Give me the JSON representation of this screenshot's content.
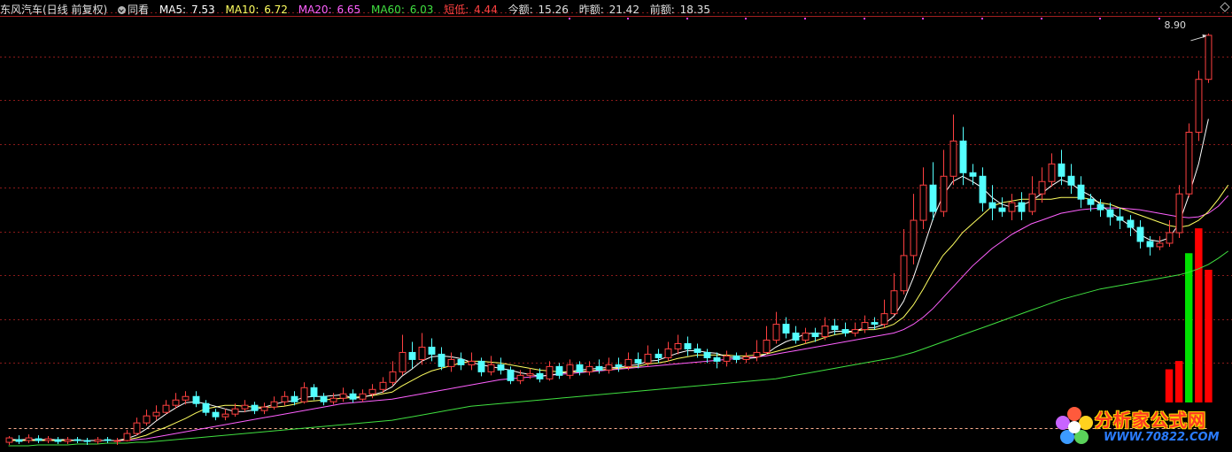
{
  "header": {
    "title": "东风汽车(日线 前复权)",
    "same_view": "同看",
    "ma5_label": "MA5:",
    "ma5_value": "7.53",
    "ma10_label": "MA10:",
    "ma10_value": "6.72",
    "ma20_label": "MA20:",
    "ma20_value": "6.65",
    "ma60_label": "MA60:",
    "ma60_value": "6.03",
    "short_low_label": "短低:",
    "short_low_value": "4.44",
    "today_amount_label": "今额:",
    "today_amount_value": "15.26",
    "yesterday_amount_label": "昨额:",
    "yesterday_amount_value": "21.42",
    "prev_amount_label": "前额:",
    "prev_amount_value": "18.35"
  },
  "price_high_label": "8.90",
  "watermark": {
    "name": "分析家公式网",
    "url": "WWW.70822.COM"
  },
  "colors": {
    "up": "#ff4040",
    "down": "#54ffff",
    "ma5": "#ffffff",
    "ma10": "#ffff60",
    "ma20": "#ff60ff",
    "ma60": "#40e040",
    "grid": "#8a1a1a",
    "amount_up": "#ff0000",
    "amount_down": "#00e000",
    "dots": "#ff40ff"
  },
  "chart_data": {
    "type": "candlestick",
    "title": "东风汽车(日线 前复权)",
    "ylim": [
      4.2,
      9.1
    ],
    "high_mark": 8.9,
    "short_low": 4.44,
    "candles": [
      [
        4.28,
        4.33,
        4.25,
        4.35
      ],
      [
        4.31,
        4.29,
        4.26,
        4.36
      ],
      [
        4.3,
        4.33,
        4.27,
        4.37
      ],
      [
        4.32,
        4.3,
        4.27,
        4.36
      ],
      [
        4.3,
        4.32,
        4.27,
        4.35
      ],
      [
        4.31,
        4.29,
        4.26,
        4.34
      ],
      [
        4.29,
        4.31,
        4.26,
        4.34
      ],
      [
        4.31,
        4.3,
        4.27,
        4.34
      ],
      [
        4.3,
        4.29,
        4.25,
        4.33
      ],
      [
        4.29,
        4.31,
        4.26,
        4.34
      ],
      [
        4.31,
        4.3,
        4.27,
        4.34
      ],
      [
        4.29,
        4.3,
        4.25,
        4.33
      ],
      [
        4.3,
        4.38,
        4.29,
        4.42
      ],
      [
        4.38,
        4.5,
        4.36,
        4.56
      ],
      [
        4.5,
        4.58,
        4.47,
        4.65
      ],
      [
        4.58,
        4.62,
        4.53,
        4.7
      ],
      [
        4.62,
        4.7,
        4.6,
        4.76
      ],
      [
        4.7,
        4.76,
        4.66,
        4.84
      ],
      [
        4.76,
        4.8,
        4.71,
        4.86
      ],
      [
        4.8,
        4.72,
        4.68,
        4.86
      ],
      [
        4.72,
        4.62,
        4.58,
        4.76
      ],
      [
        4.62,
        4.57,
        4.53,
        4.66
      ],
      [
        4.57,
        4.6,
        4.53,
        4.66
      ],
      [
        4.6,
        4.66,
        4.57,
        4.72
      ],
      [
        4.66,
        4.7,
        4.62,
        4.76
      ],
      [
        4.7,
        4.64,
        4.6,
        4.74
      ],
      [
        4.64,
        4.68,
        4.6,
        4.73
      ],
      [
        4.68,
        4.74,
        4.65,
        4.8
      ],
      [
        4.74,
        4.8,
        4.7,
        4.86
      ],
      [
        4.8,
        4.74,
        4.7,
        4.86
      ],
      [
        4.74,
        4.9,
        4.72,
        4.96
      ],
      [
        4.9,
        4.8,
        4.76,
        4.94
      ],
      [
        4.8,
        4.74,
        4.7,
        4.84
      ],
      [
        4.74,
        4.78,
        4.71,
        4.84
      ],
      [
        4.78,
        4.83,
        4.74,
        4.9
      ],
      [
        4.83,
        4.77,
        4.73,
        4.88
      ],
      [
        4.77,
        4.83,
        4.74,
        4.88
      ],
      [
        4.83,
        4.88,
        4.78,
        4.94
      ],
      [
        4.88,
        4.96,
        4.84,
        5.02
      ],
      [
        4.96,
        5.08,
        4.92,
        5.2
      ],
      [
        5.08,
        5.3,
        5.04,
        5.5
      ],
      [
        5.3,
        5.22,
        5.12,
        5.42
      ],
      [
        5.22,
        5.36,
        5.16,
        5.52
      ],
      [
        5.36,
        5.28,
        5.2,
        5.46
      ],
      [
        5.28,
        5.14,
        5.1,
        5.36
      ],
      [
        5.14,
        5.22,
        5.08,
        5.3
      ],
      [
        5.22,
        5.16,
        5.1,
        5.3
      ],
      [
        5.16,
        5.2,
        5.1,
        5.3
      ],
      [
        5.2,
        5.08,
        5.03,
        5.24
      ],
      [
        5.08,
        5.16,
        5.04,
        5.26
      ],
      [
        5.16,
        5.1,
        5.05,
        5.24
      ],
      [
        5.1,
        4.98,
        4.94,
        5.14
      ],
      [
        4.98,
        5.04,
        4.94,
        5.1
      ],
      [
        5.04,
        5.06,
        5.0,
        5.12
      ],
      [
        5.06,
        5.0,
        4.96,
        5.12
      ],
      [
        5.0,
        5.14,
        4.98,
        5.2
      ],
      [
        5.14,
        5.04,
        5.0,
        5.18
      ],
      [
        5.04,
        5.16,
        5.0,
        5.22
      ],
      [
        5.16,
        5.08,
        5.04,
        5.2
      ],
      [
        5.08,
        5.14,
        5.04,
        5.2
      ],
      [
        5.14,
        5.1,
        5.06,
        5.22
      ],
      [
        5.1,
        5.16,
        5.06,
        5.24
      ],
      [
        5.16,
        5.14,
        5.08,
        5.24
      ],
      [
        5.14,
        5.22,
        5.1,
        5.3
      ],
      [
        5.22,
        5.18,
        5.12,
        5.3
      ],
      [
        5.18,
        5.28,
        5.14,
        5.38
      ],
      [
        5.28,
        5.24,
        5.18,
        5.34
      ],
      [
        5.24,
        5.34,
        5.2,
        5.42
      ],
      [
        5.34,
        5.4,
        5.28,
        5.5
      ],
      [
        5.4,
        5.34,
        5.26,
        5.48
      ],
      [
        5.34,
        5.3,
        5.24,
        5.4
      ],
      [
        5.3,
        5.24,
        5.18,
        5.34
      ],
      [
        5.24,
        5.2,
        5.12,
        5.3
      ],
      [
        5.2,
        5.26,
        5.14,
        5.32
      ],
      [
        5.26,
        5.22,
        5.18,
        5.3
      ],
      [
        5.22,
        5.25,
        5.18,
        5.3
      ],
      [
        5.25,
        5.3,
        5.2,
        5.44
      ],
      [
        5.3,
        5.44,
        5.28,
        5.6
      ],
      [
        5.44,
        5.62,
        5.4,
        5.76
      ],
      [
        5.62,
        5.52,
        5.46,
        5.7
      ],
      [
        5.52,
        5.44,
        5.4,
        5.6
      ],
      [
        5.44,
        5.52,
        5.4,
        5.58
      ],
      [
        5.52,
        5.48,
        5.42,
        5.58
      ],
      [
        5.48,
        5.6,
        5.44,
        5.7
      ],
      [
        5.6,
        5.56,
        5.5,
        5.68
      ],
      [
        5.56,
        5.52,
        5.48,
        5.64
      ],
      [
        5.52,
        5.56,
        5.48,
        5.64
      ],
      [
        5.56,
        5.64,
        5.52,
        5.72
      ],
      [
        5.64,
        5.62,
        5.56,
        5.7
      ],
      [
        5.62,
        5.74,
        5.58,
        5.9
      ],
      [
        5.74,
        6.0,
        5.72,
        6.2
      ],
      [
        6.0,
        6.4,
        5.96,
        6.7
      ],
      [
        6.4,
        6.8,
        6.3,
        7.1
      ],
      [
        6.8,
        7.2,
        6.7,
        7.4
      ],
      [
        7.2,
        6.9,
        6.8,
        7.46
      ],
      [
        6.9,
        7.3,
        6.84,
        7.6
      ],
      [
        7.3,
        7.7,
        7.2,
        8.0
      ],
      [
        7.7,
        7.34,
        7.2,
        7.86
      ],
      [
        7.34,
        7.3,
        7.2,
        7.44
      ],
      [
        7.3,
        7.0,
        6.9,
        7.4
      ],
      [
        7.0,
        6.94,
        6.8,
        7.2
      ],
      [
        6.94,
        6.9,
        6.84,
        7.06
      ],
      [
        6.9,
        7.0,
        6.8,
        7.1
      ],
      [
        7.0,
        6.9,
        6.8,
        7.12
      ],
      [
        6.9,
        7.1,
        6.86,
        7.3
      ],
      [
        7.1,
        7.24,
        7.0,
        7.4
      ],
      [
        7.24,
        7.44,
        7.18,
        7.56
      ],
      [
        7.44,
        7.3,
        7.2,
        7.6
      ],
      [
        7.3,
        7.2,
        7.1,
        7.44
      ],
      [
        7.2,
        7.04,
        6.94,
        7.3
      ],
      [
        7.04,
        6.98,
        6.9,
        7.1
      ],
      [
        6.98,
        6.92,
        6.84,
        7.04
      ],
      [
        6.92,
        6.84,
        6.74,
        7.0
      ],
      [
        6.84,
        6.8,
        6.7,
        6.94
      ],
      [
        6.8,
        6.72,
        6.62,
        6.86
      ],
      [
        6.72,
        6.56,
        6.48,
        6.8
      ],
      [
        6.56,
        6.5,
        6.4,
        6.62
      ],
      [
        6.5,
        6.54,
        6.46,
        6.62
      ],
      [
        6.54,
        6.66,
        6.5,
        6.8
      ],
      [
        6.66,
        7.1,
        6.6,
        7.2
      ],
      [
        7.1,
        7.8,
        7.06,
        7.9
      ],
      [
        7.8,
        8.4,
        7.7,
        8.5
      ],
      [
        8.4,
        8.9,
        8.36,
        8.92
      ]
    ],
    "ma5": [
      4.31,
      4.31,
      4.31,
      4.31,
      4.31,
      4.31,
      4.31,
      4.3,
      4.3,
      4.3,
      4.3,
      4.3,
      4.32,
      4.36,
      4.43,
      4.52,
      4.6,
      4.67,
      4.73,
      4.74,
      4.72,
      4.69,
      4.66,
      4.63,
      4.63,
      4.65,
      4.68,
      4.71,
      4.74,
      4.75,
      4.79,
      4.8,
      4.8,
      4.81,
      4.82,
      4.78,
      4.79,
      4.82,
      4.85,
      4.91,
      5.03,
      5.11,
      5.2,
      5.25,
      5.26,
      5.25,
      5.23,
      5.19,
      5.16,
      5.14,
      5.12,
      5.1,
      5.07,
      5.05,
      5.03,
      5.04,
      5.06,
      5.08,
      5.1,
      5.11,
      5.12,
      5.13,
      5.13,
      5.15,
      5.16,
      5.2,
      5.21,
      5.25,
      5.29,
      5.32,
      5.32,
      5.3,
      5.29,
      5.25,
      5.24,
      5.23,
      5.24,
      5.28,
      5.36,
      5.42,
      5.46,
      5.51,
      5.52,
      5.51,
      5.54,
      5.54,
      5.54,
      5.58,
      5.58,
      5.62,
      5.71,
      5.88,
      6.15,
      6.48,
      6.82,
      7.08,
      7.24,
      7.3,
      7.24,
      7.17,
      7.06,
      6.98,
      6.95,
      6.97,
      7.02,
      7.1,
      7.19,
      7.26,
      7.22,
      7.14,
      7.08,
      6.98,
      6.89,
      6.82,
      6.74,
      6.64,
      6.58,
      6.56,
      6.6,
      6.76,
      7.08,
      7.44,
      7.95
    ],
    "ma10": [
      4.3,
      4.3,
      4.3,
      4.3,
      4.3,
      4.3,
      4.3,
      4.3,
      4.3,
      4.3,
      4.3,
      4.3,
      4.31,
      4.33,
      4.36,
      4.41,
      4.45,
      4.5,
      4.55,
      4.61,
      4.66,
      4.68,
      4.7,
      4.7,
      4.69,
      4.68,
      4.68,
      4.68,
      4.69,
      4.71,
      4.74,
      4.75,
      4.76,
      4.77,
      4.78,
      4.79,
      4.8,
      4.81,
      4.83,
      4.85,
      4.92,
      4.98,
      5.04,
      5.09,
      5.12,
      5.15,
      5.18,
      5.2,
      5.2,
      5.19,
      5.18,
      5.16,
      5.14,
      5.12,
      5.1,
      5.09,
      5.08,
      5.08,
      5.08,
      5.09,
      5.1,
      5.11,
      5.12,
      5.13,
      5.14,
      5.17,
      5.18,
      5.2,
      5.23,
      5.25,
      5.27,
      5.27,
      5.27,
      5.27,
      5.26,
      5.26,
      5.27,
      5.28,
      5.31,
      5.34,
      5.37,
      5.4,
      5.43,
      5.47,
      5.5,
      5.52,
      5.54,
      5.56,
      5.56,
      5.58,
      5.62,
      5.7,
      5.84,
      6.02,
      6.22,
      6.4,
      6.52,
      6.66,
      6.76,
      6.86,
      6.96,
      7.0,
      7.02,
      7.04,
      7.04,
      7.04,
      7.04,
      7.06,
      7.06,
      7.06,
      7.04,
      7.0,
      6.98,
      6.94,
      6.9,
      6.86,
      6.82,
      6.78,
      6.74,
      6.72,
      6.74,
      6.8,
      6.9,
      7.04,
      7.2
    ],
    "ma20": [
      4.3,
      4.3,
      4.3,
      4.3,
      4.3,
      4.3,
      4.3,
      4.3,
      4.3,
      4.3,
      4.3,
      4.3,
      4.3,
      4.31,
      4.32,
      4.34,
      4.36,
      4.38,
      4.4,
      4.42,
      4.44,
      4.46,
      4.48,
      4.5,
      4.52,
      4.54,
      4.56,
      4.58,
      4.6,
      4.62,
      4.64,
      4.66,
      4.68,
      4.7,
      4.72,
      4.73,
      4.74,
      4.75,
      4.76,
      4.77,
      4.79,
      4.81,
      4.83,
      4.85,
      4.87,
      4.89,
      4.91,
      4.93,
      4.95,
      4.97,
      4.99,
      5.0,
      5.01,
      5.02,
      5.03,
      5.04,
      5.05,
      5.06,
      5.07,
      5.08,
      5.09,
      5.1,
      5.11,
      5.12,
      5.13,
      5.14,
      5.15,
      5.16,
      5.17,
      5.18,
      5.19,
      5.2,
      5.21,
      5.22,
      5.23,
      5.24,
      5.25,
      5.26,
      5.28,
      5.3,
      5.32,
      5.34,
      5.36,
      5.38,
      5.4,
      5.42,
      5.44,
      5.46,
      5.48,
      5.5,
      5.52,
      5.56,
      5.62,
      5.7,
      5.8,
      5.92,
      6.04,
      6.16,
      6.28,
      6.38,
      6.48,
      6.56,
      6.64,
      6.7,
      6.76,
      6.8,
      6.84,
      6.88,
      6.9,
      6.92,
      6.93,
      6.94,
      6.94,
      6.94,
      6.93,
      6.92,
      6.9,
      6.88,
      6.86,
      6.84,
      6.83,
      6.84,
      6.88,
      6.96,
      7.08
    ],
    "ma60": [
      4.24,
      4.24,
      4.24,
      4.25,
      4.25,
      4.25,
      4.25,
      4.26,
      4.26,
      4.26,
      4.27,
      4.27,
      4.27,
      4.28,
      4.28,
      4.29,
      4.3,
      4.31,
      4.32,
      4.33,
      4.34,
      4.35,
      4.36,
      4.37,
      4.38,
      4.39,
      4.4,
      4.41,
      4.42,
      4.43,
      4.44,
      4.45,
      4.46,
      4.47,
      4.48,
      4.49,
      4.5,
      4.51,
      4.52,
      4.53,
      4.55,
      4.57,
      4.59,
      4.61,
      4.63,
      4.65,
      4.67,
      4.69,
      4.7,
      4.71,
      4.72,
      4.73,
      4.74,
      4.75,
      4.76,
      4.77,
      4.78,
      4.79,
      4.8,
      4.81,
      4.82,
      4.83,
      4.84,
      4.85,
      4.86,
      4.87,
      4.88,
      4.89,
      4.9,
      4.91,
      4.92,
      4.93,
      4.94,
      4.95,
      4.96,
      4.97,
      4.98,
      4.99,
      5.0,
      5.02,
      5.04,
      5.06,
      5.08,
      5.1,
      5.12,
      5.14,
      5.16,
      5.18,
      5.2,
      5.22,
      5.24,
      5.27,
      5.3,
      5.34,
      5.38,
      5.42,
      5.46,
      5.5,
      5.54,
      5.58,
      5.62,
      5.66,
      5.7,
      5.74,
      5.78,
      5.82,
      5.86,
      5.9,
      5.93,
      5.96,
      5.99,
      6.02,
      6.04,
      6.06,
      6.08,
      6.1,
      6.12,
      6.14,
      6.16,
      6.18,
      6.21,
      6.25,
      6.3,
      6.37,
      6.45
    ],
    "amounts": [
      {
        "value": 6.0,
        "dir": "up"
      },
      {
        "value": 7.5,
        "dir": "up"
      },
      {
        "value": 27.0,
        "dir": "down"
      },
      {
        "value": 31.5,
        "dir": "up"
      },
      {
        "value": 24.0,
        "dir": "up"
      }
    ]
  }
}
